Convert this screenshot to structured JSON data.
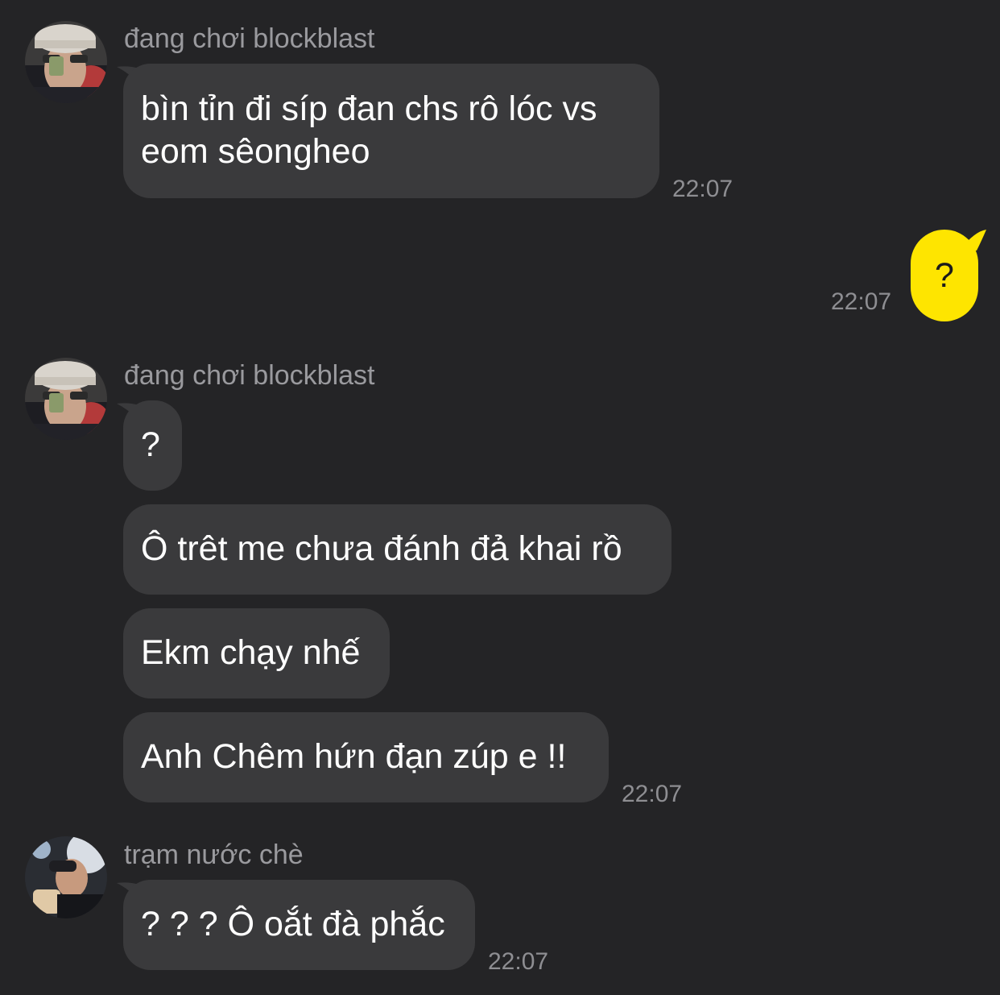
{
  "groups": [
    {
      "sender": "đang chơi blockblast",
      "avatar_icon": "profile-photo-icon",
      "messages": [
        {
          "line1": "bìn tỉn đi síp đan chs rô lóc vs",
          "line2": "eom sêongheo"
        }
      ],
      "time": "22:07"
    },
    {
      "sender": "đang chơi blockblast",
      "avatar_icon": "profile-photo-icon",
      "messages": [
        {
          "text": "?"
        },
        {
          "text": "Ô trêt me chưa đánh đả khai rồ"
        },
        {
          "text": "Ekm chạy nhế"
        },
        {
          "text": "Anh Chêm hứn đạn zúp e !!"
        }
      ],
      "time": "22:07"
    },
    {
      "sender": "trạm nước chè",
      "avatar_icon": "profile-photo-icon",
      "messages": [
        {
          "text": "? ? ? Ô oắt đà phắc"
        }
      ],
      "time": "22:07"
    }
  ],
  "my_message": {
    "text": "?",
    "time": "22:07",
    "bubble_color": "#fee500"
  },
  "colors": {
    "background": "#242426",
    "incoming_bubble": "#3a3a3c",
    "sender_text": "#9a9a9e",
    "timestamp_text": "#8e8e92"
  }
}
